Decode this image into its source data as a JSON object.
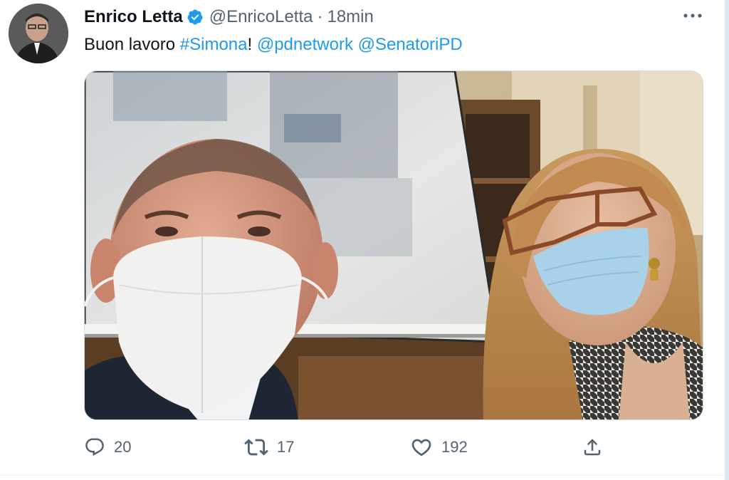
{
  "tweet": {
    "author": {
      "name": "Enrico Letta",
      "handle": "@EnricoLetta",
      "verified": true
    },
    "separator": "·",
    "time": "18min",
    "text": {
      "prefix": "Buon lavoro ",
      "hashtag": "#Simona",
      "after_hashtag": "! ",
      "mention1": "@pdnetwork",
      "space": " ",
      "mention2": "@SenatoriPD"
    },
    "media": {
      "kind": "photo"
    },
    "actions": {
      "replies": "20",
      "retweets": "17",
      "likes": "192"
    }
  },
  "colors": {
    "accent": "#1d9bf0",
    "text_primary": "#0f1419",
    "text_secondary": "#536471"
  },
  "icons": {
    "more": "more-horizontal-icon",
    "verified": "verified-badge-icon",
    "reply": "reply-icon",
    "retweet": "retweet-icon",
    "like": "heart-icon",
    "share": "share-icon"
  }
}
